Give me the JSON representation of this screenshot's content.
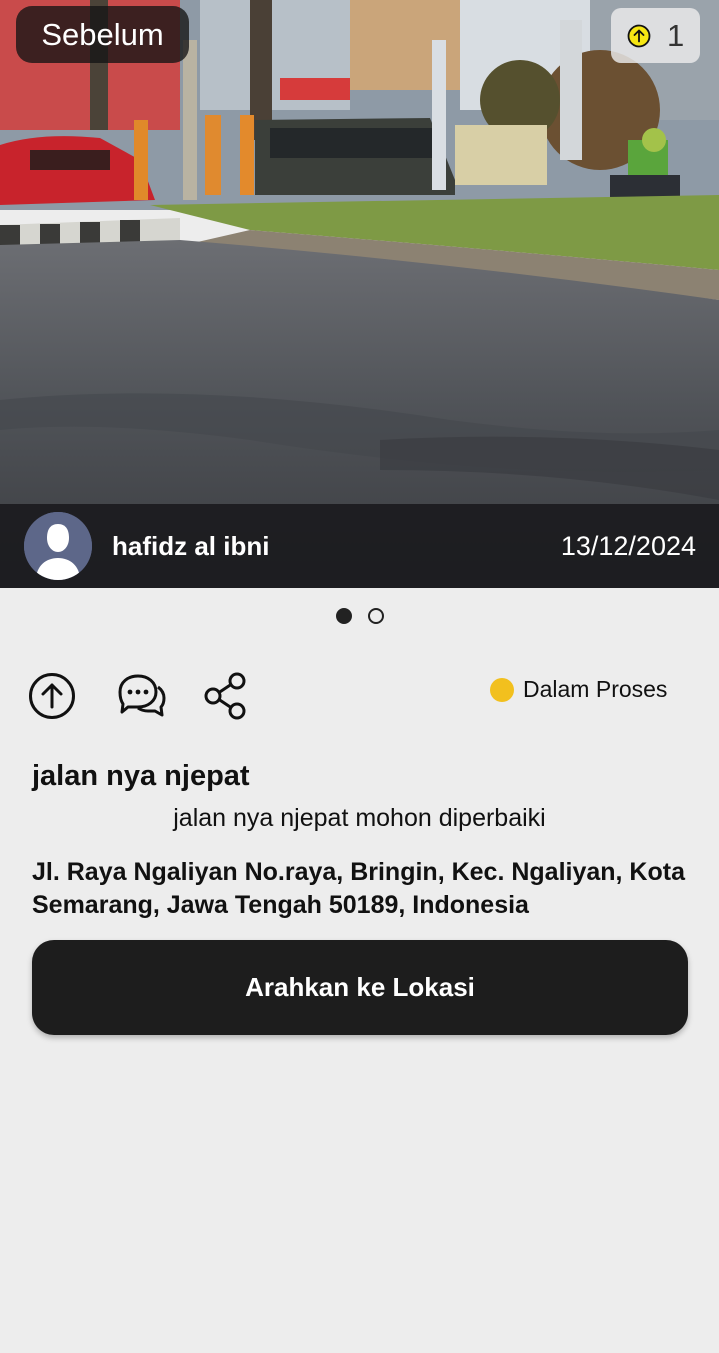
{
  "photo": {
    "before_label": "Sebelum",
    "upvote_count": "1",
    "author_name": "hafidz al ibni",
    "date": "13/12/2024"
  },
  "pager": {
    "total": 2,
    "active_index": 0
  },
  "actions": {
    "icons": [
      "upvote-icon",
      "comment-icon",
      "share-icon"
    ],
    "status_label": "Dalam Proses",
    "status_color": "#f2c01e"
  },
  "report": {
    "title": "jalan nya njepat",
    "description": "jalan nya njepat mohon diperbaiki",
    "address": "Jl. Raya Ngaliyan No.raya, Bringin, Kec. Ngaliyan, Kota Semarang, Jawa Tengah 50189, Indonesia"
  },
  "cta_label": "Arahkan ke Lokasi"
}
